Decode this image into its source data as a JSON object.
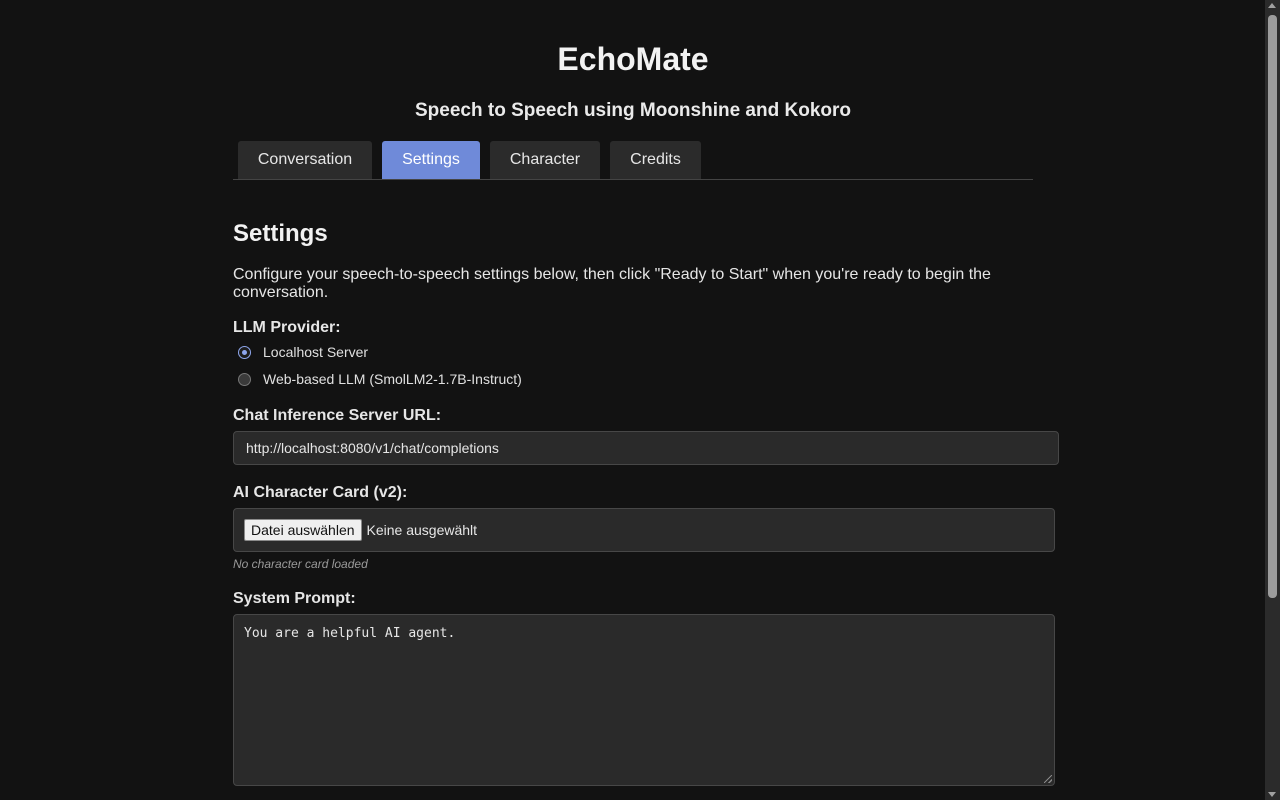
{
  "header": {
    "title": "EchoMate",
    "subtitle": "Speech to Speech using Moonshine and Kokoro"
  },
  "tabs": [
    {
      "label": "Conversation",
      "active": false
    },
    {
      "label": "Settings",
      "active": true
    },
    {
      "label": "Character",
      "active": false
    },
    {
      "label": "Credits",
      "active": false
    }
  ],
  "settings": {
    "title": "Settings",
    "intro": "Configure your speech-to-speech settings below, then click \"Ready to Start\" when you're ready to begin the conversation.",
    "llm_provider": {
      "label": "LLM Provider:",
      "options": [
        {
          "label": "Localhost Server",
          "selected": true
        },
        {
          "label": "Web-based LLM (SmolLM2-1.7B-Instruct)",
          "selected": false
        }
      ]
    },
    "server_url": {
      "label": "Chat Inference Server URL:",
      "value": "http://localhost:8080/v1/chat/completions"
    },
    "character_card": {
      "label": "AI Character Card (v2):",
      "button_label": "Datei auswählen",
      "file_status": "Keine ausgewählt",
      "hint": "No character card loaded"
    },
    "system_prompt": {
      "label": "System Prompt:",
      "value": "You are a helpful AI agent."
    }
  },
  "colors": {
    "background": "#121212",
    "accent": "#6f8ad9",
    "tab_inactive": "#2b2b2b",
    "input_bg": "#2a2a2a"
  }
}
